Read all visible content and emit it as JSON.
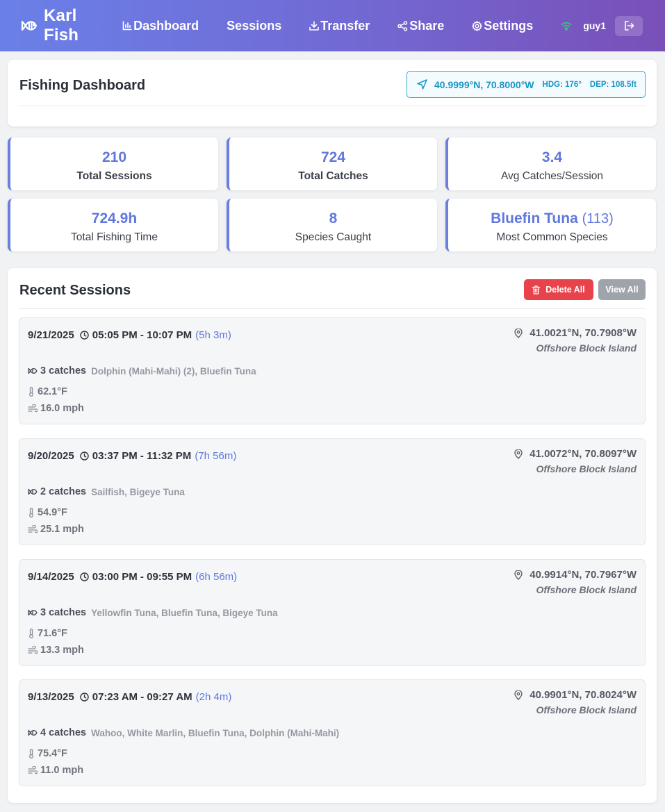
{
  "app": {
    "name": "Karl Fish",
    "icon": "fish-icon"
  },
  "nav": {
    "items": [
      {
        "label": "Dashboard",
        "icon": "bar-chart-icon"
      },
      {
        "label": "Sessions",
        "icon": ""
      },
      {
        "label": "Transfer",
        "icon": "download-icon"
      },
      {
        "label": "Share",
        "icon": "share-icon"
      },
      {
        "label": "Settings",
        "icon": "gear-icon"
      }
    ],
    "username": "guy1",
    "status_icon": "wifi-icon",
    "logout_icon": "logout-icon"
  },
  "dashboard": {
    "title": "Fishing Dashboard",
    "gps": {
      "coords": "40.9999°N, 70.8000°W",
      "heading": "HDG: 176°",
      "depth": "DEP: 108.5ft",
      "icon": "navigation-arrow-icon"
    }
  },
  "stats": {
    "total_sessions": {
      "value": "210",
      "label": "Total Sessions"
    },
    "total_catches": {
      "value": "724",
      "label": "Total Catches"
    },
    "avg_catches": {
      "value": "3.4",
      "label": "Avg Catches/Session"
    },
    "fishing_time": {
      "value": "724.9h",
      "label": "Total Fishing Time"
    },
    "species_caught": {
      "value": "8",
      "label": "Species Caught"
    },
    "common_species": {
      "value": "Bluefin Tuna",
      "count": "(113)",
      "label": "Most Common Species"
    }
  },
  "recent": {
    "title": "Recent Sessions",
    "delete_all": "Delete All",
    "view_all": "View All",
    "sessions": [
      {
        "date": "9/21/2025",
        "time": "05:05 PM - 10:07 PM",
        "duration": "(5h 3m)",
        "coords": "41.0021°N, 70.7908°W",
        "place": "Offshore Block Island",
        "catches": "3 catches",
        "species": "Dolphin (Mahi-Mahi) (2), Bluefin Tuna",
        "temp": "62.1°F",
        "wind": "16.0 mph"
      },
      {
        "date": "9/20/2025",
        "time": "03:37 PM - 11:32 PM",
        "duration": "(7h 56m)",
        "coords": "41.0072°N, 70.8097°W",
        "place": "Offshore Block Island",
        "catches": "2 catches",
        "species": "Sailfish, Bigeye Tuna",
        "temp": "54.9°F",
        "wind": "25.1 mph"
      },
      {
        "date": "9/14/2025",
        "time": "03:00 PM - 09:55 PM",
        "duration": "(6h 56m)",
        "coords": "40.9914°N, 70.7967°W",
        "place": "Offshore Block Island",
        "catches": "3 catches",
        "species": "Yellowfin Tuna, Bluefin Tuna, Bigeye Tuna",
        "temp": "71.6°F",
        "wind": "13.3 mph"
      },
      {
        "date": "9/13/2025",
        "time": "07:23 AM - 09:27 AM",
        "duration": "(2h 4m)",
        "coords": "40.9901°N, 70.8024°W",
        "place": "Offshore Block Island",
        "catches": "4 catches",
        "species": "Wahoo, White Marlin, Bluefin Tuna, Dolphin (Mahi-Mahi)",
        "temp": "75.4°F",
        "wind": "11.0 mph"
      }
    ]
  },
  "colors": {
    "accent": "#6077dd",
    "nav_gradient_start": "#6a80e8",
    "nav_gradient_end": "#7a4fb8",
    "gps": "#1796c4",
    "danger": "#e8434a",
    "muted_button": "#9fa3aa"
  }
}
